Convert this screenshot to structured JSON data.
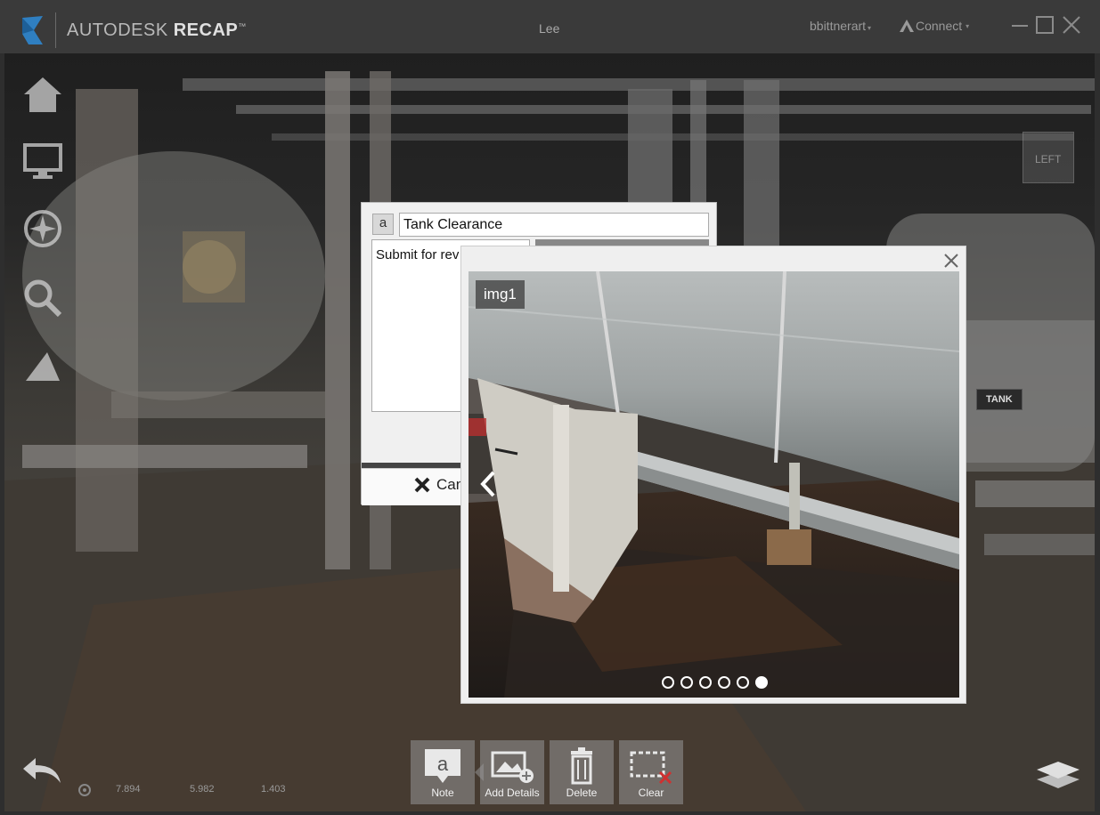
{
  "app": {
    "brand_light": "AUTODESK",
    "brand_bold": "RECAP",
    "brand_tm": "™",
    "project_name": "Lee",
    "user": "bbittnerart",
    "connect": "Connect",
    "accent_color": "#2f7fc1"
  },
  "left_tools": [
    "home-icon",
    "display-icon",
    "navigate-icon",
    "search-icon",
    "measure-icon"
  ],
  "viewcube": {
    "face": "LEFT"
  },
  "scene_tag": "TANK",
  "note_editor": {
    "title_value": "Tank Clearance",
    "description_value": "Submit for rev",
    "cancel_label": "Can"
  },
  "image_viewer": {
    "caption": "img1",
    "dots_total": 6,
    "active_dot": 6
  },
  "bottom_toolbar": {
    "note": "Note",
    "add_details": "Add Details",
    "delete": "Delete",
    "clear": "Clear"
  },
  "coordinates": {
    "x": "7.894",
    "y": "5.982",
    "z": "1.403"
  }
}
